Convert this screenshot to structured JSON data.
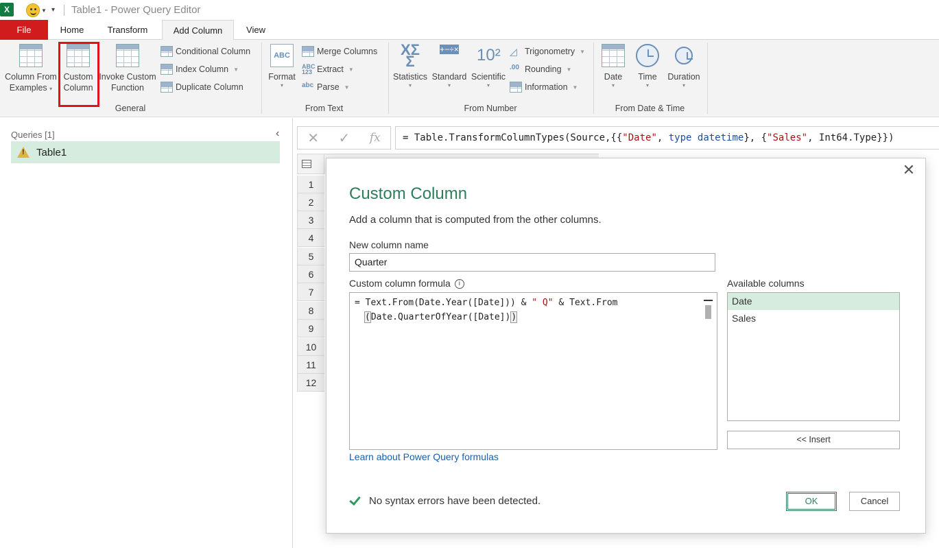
{
  "app": {
    "logo": "X",
    "title": "Table1 - Power Query Editor"
  },
  "tabs": [
    "File",
    "Home",
    "Transform",
    "Add Column",
    "View"
  ],
  "ribbon": {
    "general": {
      "label": "General",
      "column_from_examples": [
        "Column From",
        "Examples"
      ],
      "custom_column": [
        "Custom",
        "Column"
      ],
      "invoke_custom_function": [
        "Invoke Custom",
        "Function"
      ],
      "conditional_column": "Conditional Column",
      "index_column": "Index Column",
      "duplicate_column": "Duplicate Column"
    },
    "from_text": {
      "label": "From Text",
      "format": "Format",
      "merge_columns": "Merge Columns",
      "extract": "Extract",
      "parse": "Parse"
    },
    "from_number": {
      "label": "From Number",
      "statistics": "Statistics",
      "standard": "Standard",
      "scientific": "Scientific",
      "trigonometry": "Trigonometry",
      "rounding": "Rounding",
      "information": "Information"
    },
    "from_date_time": {
      "label": "From Date & Time",
      "date": "Date",
      "time": "Time",
      "duration": "Duration"
    }
  },
  "queries": {
    "title": "Queries [1]",
    "items": [
      "Table1"
    ]
  },
  "formula_bar": {
    "prefix": "= Table.TransformColumnTypes(Source,{{",
    "s1": "\"Date\"",
    "m1": ", ",
    "k1": "type",
    "m2": " ",
    "k2": "datetime",
    "m3": "}, {",
    "s2": "\"Sales\"",
    "suffix": ", Int64.Type}})"
  },
  "grid": {
    "row_numbers": [
      "1",
      "2",
      "3",
      "4",
      "5",
      "6",
      "7",
      "8",
      "9",
      "10",
      "11",
      "12"
    ]
  },
  "dialog": {
    "title": "Custom Column",
    "subtitle": "Add a column that is computed from the other columns.",
    "new_column_name_label": "New column name",
    "new_column_name_value": "Quarter",
    "formula_label": "Custom column formula",
    "formula_line1_a": "= Text.From(Date.Year([Date])) & ",
    "formula_line1_str": "\" Q\"",
    "formula_line1_b": " & Text.From",
    "formula_line2_open": "(",
    "formula_line2_mid": "Date.QuarterOfYear([Date])",
    "formula_line2_close": ")",
    "available_label": "Available columns",
    "available_columns": [
      "Date",
      "Sales"
    ],
    "insert_label": "<< Insert",
    "learn_link": "Learn about Power Query formulas",
    "status": "No syntax errors have been detected.",
    "ok_label": "OK",
    "cancel_label": "Cancel"
  },
  "colors": {
    "file_tab": "#d01c1c",
    "accent_green": "#2e7d5b",
    "selection": "#d6ecdf",
    "link": "#1a5fa8",
    "highlight_box": "#e0101e"
  }
}
